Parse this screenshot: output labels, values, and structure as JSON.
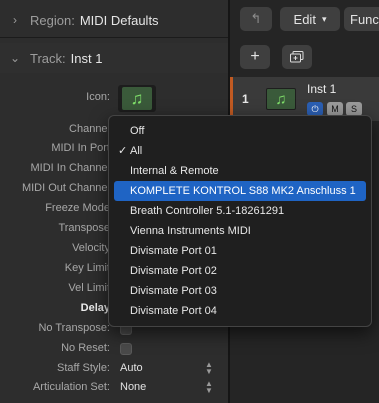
{
  "inspector": {
    "region": {
      "label": "Region:",
      "value": "MIDI Defaults"
    },
    "track": {
      "label": "Track:",
      "value": "Inst 1"
    },
    "icon_label": "Icon:",
    "fields": [
      {
        "label": "Channel"
      },
      {
        "label": "MIDI In Port"
      },
      {
        "label": "MIDI In Channel"
      },
      {
        "label": "MIDI Out Channel"
      },
      {
        "label": "Freeze Mode"
      },
      {
        "label": "Transpose"
      },
      {
        "label": "Velocity"
      },
      {
        "label": "Key Limit"
      },
      {
        "label": "Vel Limit"
      },
      {
        "label": "Delay"
      },
      {
        "label": "No Transpose:"
      },
      {
        "label": "No Reset:"
      },
      {
        "label": "Staff Style:",
        "value": "Auto"
      },
      {
        "label": "Articulation Set:",
        "value": "None"
      }
    ]
  },
  "toolbar": {
    "back_icon": "arrow-up-left-icon",
    "edit_label": "Edit",
    "functions_label": "Func",
    "add_label": "+",
    "duplicate_icon": "duplicate-track-icon"
  },
  "track_row": {
    "number": "1",
    "name": "Inst 1",
    "m_label": "M",
    "s_label": "S",
    "power_icon": "power-icon"
  },
  "menu": {
    "items": [
      {
        "label": "Off",
        "checked": false,
        "selected": false
      },
      {
        "label": "All",
        "checked": true,
        "selected": false
      },
      {
        "label": "Internal & Remote",
        "checked": false,
        "selected": false
      },
      {
        "label": "KOMPLETE KONTROL S88 MK2 Anschluss 1",
        "checked": false,
        "selected": true
      },
      {
        "label": "Breath Controller 5.1-18261291",
        "checked": false,
        "selected": false
      },
      {
        "label": "Vienna Instruments MIDI",
        "checked": false,
        "selected": false
      },
      {
        "label": "Divismate Port 01",
        "checked": false,
        "selected": false
      },
      {
        "label": "Divismate Port 02",
        "checked": false,
        "selected": false
      },
      {
        "label": "Divismate Port 03",
        "checked": false,
        "selected": false
      },
      {
        "label": "Divismate Port 04",
        "checked": false,
        "selected": false
      }
    ],
    "check_glyph": "✓"
  },
  "colors": {
    "accent": "#1f64c4",
    "track_marker": "#c15a22",
    "instrument_green": "#7fe06a"
  }
}
